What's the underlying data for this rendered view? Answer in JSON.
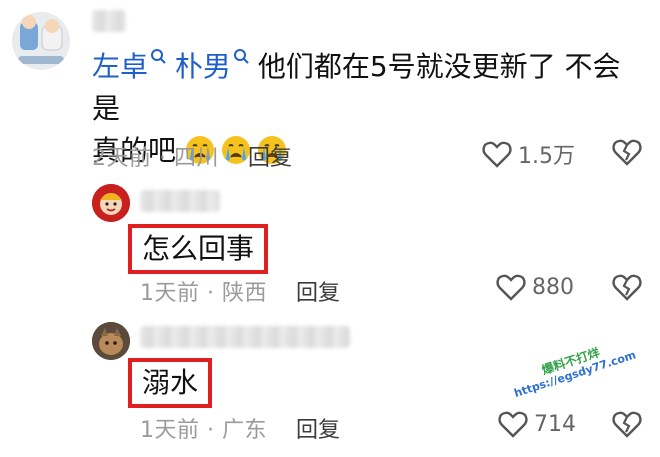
{
  "comment": {
    "mentions": [
      "左卓",
      "朴男"
    ],
    "text_line1": "他们都在5号就没更新了 不会是",
    "text_line2": "真的吧",
    "meta": "2天前 · 四川",
    "reply_label": "回复",
    "likes": "1.5万",
    "emoji_icon": "crying-face-emoji"
  },
  "replies": [
    {
      "text": "怎么回事",
      "meta": "1天前 · 陕西",
      "reply_label": "回复",
      "likes": "880"
    },
    {
      "text": "溺水",
      "meta": "1天前 · 广东",
      "reply_label": "回复",
      "likes": "714"
    }
  ],
  "watermark": {
    "line1": "爆料不打烊",
    "line2": "https://egsdy77.com"
  },
  "colors": {
    "mention": "#1f5fcc",
    "highlight_box": "#e02020",
    "meta_text": "#9b9b9b"
  }
}
